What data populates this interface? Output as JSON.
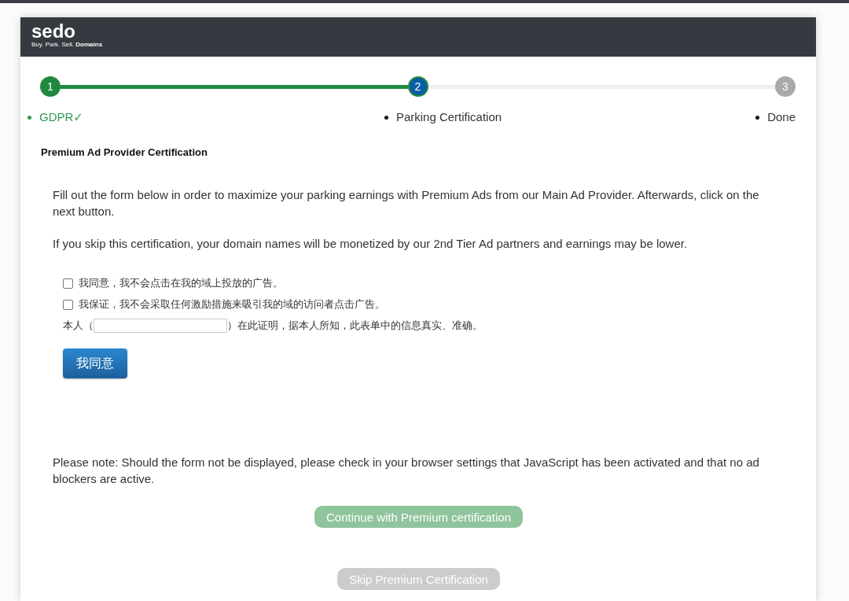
{
  "header": {
    "logo": "sedo",
    "tagline": "Buy. Park. Sell. **Domains**"
  },
  "steps": [
    {
      "number": "1",
      "label": "GDPR✓",
      "completed": true,
      "selected": false
    },
    {
      "number": "2",
      "label": "Parking Certification",
      "completed": false,
      "selected": true
    },
    {
      "number": "3",
      "label": "Done",
      "completed": false,
      "selected": false
    }
  ],
  "heading": "Premium Ad Provider Certification",
  "intro": [
    "Fill out the form below in order to maximize your parking earnings with Premium Ads from our Main Ad Provider. Afterwards, click on the next button.",
    "If you skip this certification, your domain names will be monetized by our 2nd Tier Ad partners and earnings may be lower."
  ],
  "agreements": [
    {
      "label": "我同意，我不会点击在我的域上投放的广告。",
      "checked": false
    },
    {
      "label": "我保证，我不会采取任何激励措施来吸引我的域的访问者点击广告。",
      "checked": false
    }
  ],
  "declaration": {
    "before": "本人（",
    "after": "）在此证明，据本人所知，此表单中的信息真实、准确。"
  },
  "agree_button": "我同意",
  "note": "Please note: Should the form not be displayed, please check in your browser settings that JavaScript has been activated and that no ad blockers are active.",
  "buttons": [
    {
      "label": "Continue with Premium certification",
      "kind": "primary",
      "disabled": true
    },
    {
      "label": "Skip Premium Certification",
      "kind": "secondary",
      "disabled": true
    }
  ]
}
